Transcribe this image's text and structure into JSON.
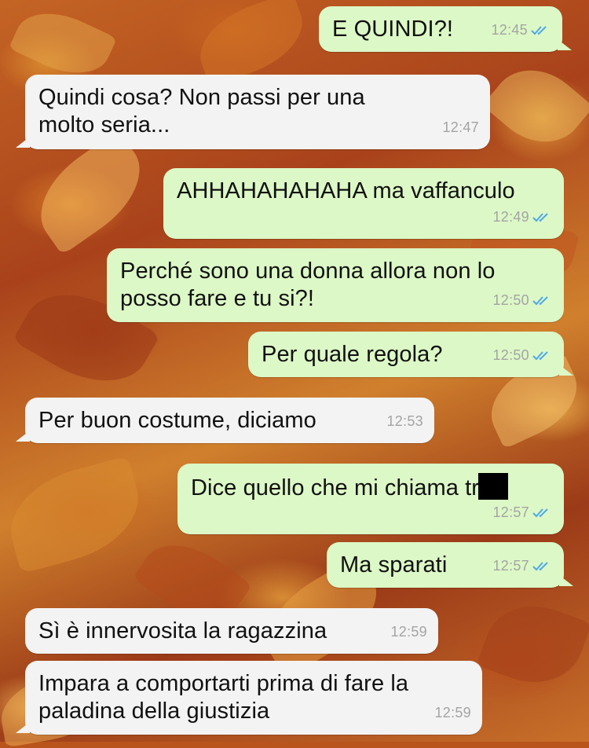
{
  "chat": {
    "messages": [
      {
        "direction": "outgoing",
        "text": "E QUINDI?!",
        "time": "12:45",
        "status": "read"
      },
      {
        "direction": "incoming",
        "text": "Quindi cosa? Non passi per una\nmolto seria...",
        "time": "12:47"
      },
      {
        "direction": "outgoing",
        "text": "AHHAHAHAHAHA ma vaffanculo",
        "time": "12:49",
        "status": "read"
      },
      {
        "direction": "outgoing",
        "text": "Perché sono una donna allora non lo\nposso fare e tu si?!",
        "time": "12:50",
        "status": "read"
      },
      {
        "direction": "outgoing",
        "text": "Per quale regola?",
        "time": "12:50",
        "status": "read"
      },
      {
        "direction": "incoming",
        "text": "Per buon costume, diciamo",
        "time": "12:53"
      },
      {
        "direction": "outgoing",
        "text": "Dice quello che mi chiama tr",
        "text_redacted_tail": true,
        "time": "12:57",
        "status": "read"
      },
      {
        "direction": "outgoing",
        "text": "Ma sparati",
        "time": "12:57",
        "status": "read"
      },
      {
        "direction": "incoming",
        "text": "Sì è innervosita la ragazzina",
        "time": "12:59"
      },
      {
        "direction": "incoming",
        "text": "Impara a comportarti prima di fare la\npaladina della giustizia",
        "time": "12:59"
      }
    ]
  },
  "colors": {
    "outgoing_bubble": "#dcf8c6",
    "incoming_bubble": "#f3f3f3",
    "read_ticks": "#4fa8e8",
    "timestamp": "#a4a4a4",
    "wallpaper": "#b8541c"
  },
  "icons": {
    "read_receipt": "double-check-icon",
    "redaction": "black-redaction-box"
  }
}
